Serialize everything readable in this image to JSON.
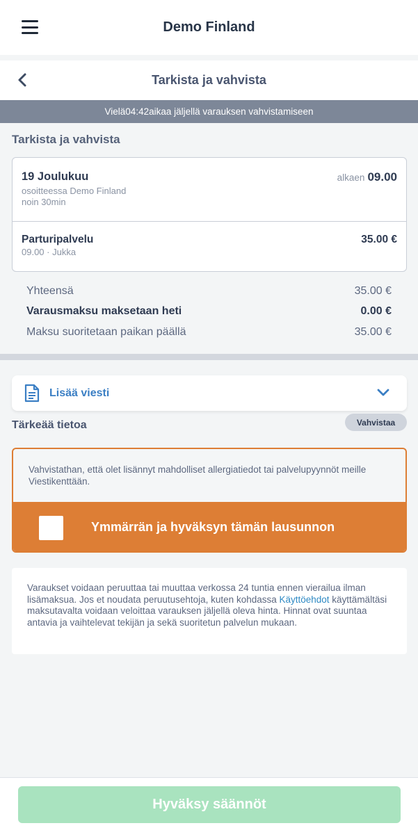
{
  "header": {
    "title": "Demo Finland",
    "menu_icon": "hamburger-menu-icon"
  },
  "subheader": {
    "title": "Tarkista ja vahvista",
    "back_icon": "chevron-left-icon"
  },
  "timer": {
    "prefix": "Vielä",
    "time": "04:42",
    "suffix": "aikaa jäljellä varauksen vahvistamiseen"
  },
  "section_title": "Tarkista ja vahvista",
  "booking": {
    "date": "19 Joulukuu",
    "location": "osoitteessa Demo Finland",
    "duration": "noin 30min",
    "start_prefix": "alkaen",
    "start_time": "09.00"
  },
  "service": {
    "name": "Parturipalvelu",
    "time": "09.00",
    "staff": "Jukka",
    "price": "35.00 €"
  },
  "summary": {
    "total_label": "Yhteensä",
    "total_value": "35.00 €",
    "deposit_label": "Varausmaksu maksetaan heti",
    "deposit_value": "0.00 €",
    "onsite_label": "Maksu suoritetaan paikan päällä",
    "onsite_value": "35.00 €"
  },
  "message": {
    "label": "Lisää viesti",
    "icon": "document-icon",
    "expand_icon": "chevron-down-icon"
  },
  "important": {
    "title": "Tärkeää tietoa",
    "badge": "Vahvistaa",
    "text": "Vahvistathan, että olet lisännyt mahdolliset allergiatiedot tai palvelupyynnöt meille Viestikenttään.",
    "accept_label": "Ymmärrän ja hyväksyn tämän lausunnon",
    "checked": false
  },
  "policy": {
    "text_before": "Varaukset voidaan peruuttaa tai muuttaa verkossa 24 tuntia ennen vierailua ilman lisämaksua. Jos et noudata peruutusehtoja, kuten kohdassa ",
    "link": "Käyttöehdot",
    "text_after": " käyttämältäsi maksutavalta voidaan veloittaa varauksen jäljellä oleva hinta. Hinnat ovat suuntaa antavia ja vaihtelevat tekijän ja sekä suoritetun palvelun mukaan."
  },
  "footer": {
    "button_label": "Hyväksy säännöt"
  },
  "colors": {
    "accent_orange": "#dd7e35",
    "link_blue": "#3b7fc4",
    "button_disabled_green": "#a9e3bf",
    "timer_bar": "#7d8798"
  }
}
